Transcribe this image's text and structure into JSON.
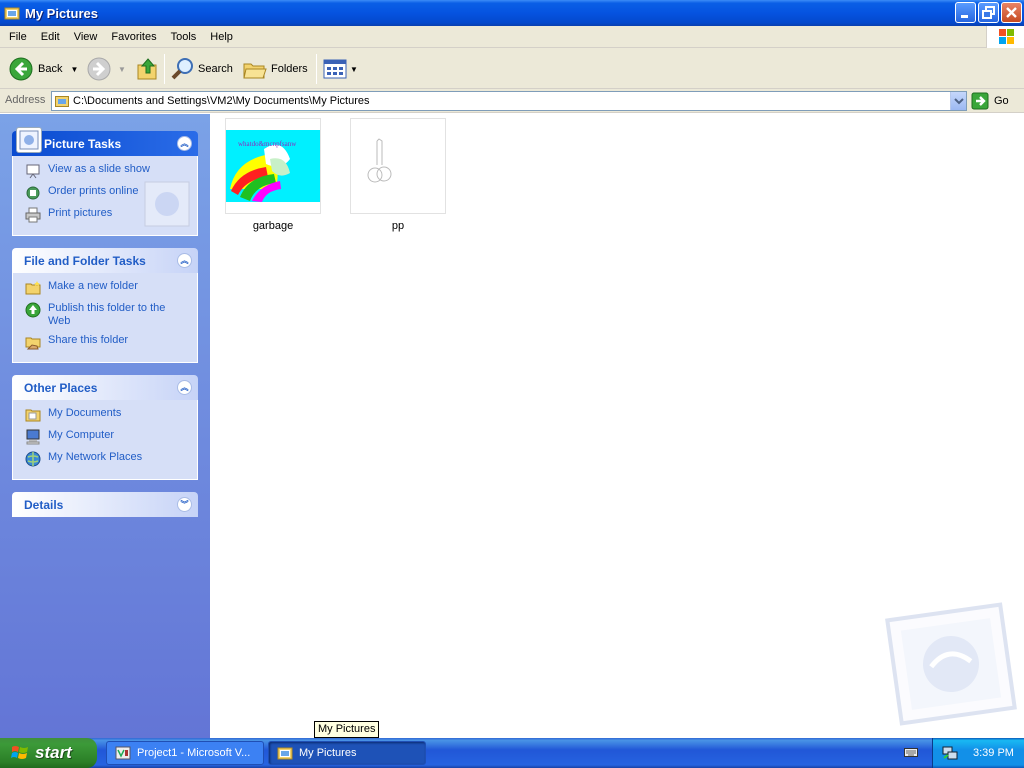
{
  "window": {
    "title": "My Pictures"
  },
  "menubar": {
    "items": [
      "File",
      "Edit",
      "View",
      "Favorites",
      "Tools",
      "Help"
    ]
  },
  "toolbar": {
    "back_label": "Back",
    "search_label": "Search",
    "folders_label": "Folders"
  },
  "address": {
    "label": "Address",
    "value": "C:\\Documents and Settings\\VM2\\My Documents\\My Pictures",
    "go_label": "Go"
  },
  "taskpane": {
    "picture_tasks": {
      "title": "Picture Tasks",
      "items": [
        "View as a slide show",
        "Order prints online",
        "Print pictures"
      ]
    },
    "file_folder_tasks": {
      "title": "File and Folder Tasks",
      "items": [
        "Make a new folder",
        "Publish this folder to the Web",
        "Share this folder"
      ]
    },
    "other_places": {
      "title": "Other Places",
      "items": [
        "My Documents",
        "My Computer",
        "My Network Places"
      ]
    },
    "details": {
      "title": "Details"
    }
  },
  "files": [
    {
      "name": "garbage",
      "thumb_text": "whatdo&mcnpfsanw"
    },
    {
      "name": "pp"
    }
  ],
  "tooltip": "My Pictures",
  "taskbar": {
    "start_label": "start",
    "tasks": [
      "Project1 - Microsoft V...",
      "My Pictures"
    ],
    "clock": "3:39 PM"
  }
}
